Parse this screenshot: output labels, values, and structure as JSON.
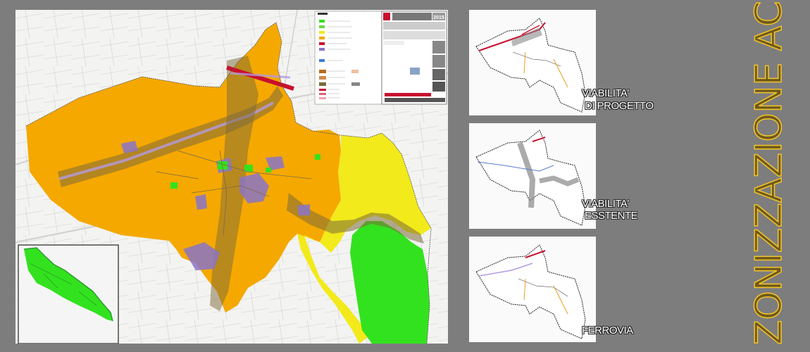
{
  "main_map": {
    "title_block": {
      "year": "2015"
    }
  },
  "thumbnails": [
    {
      "caption_line1": "VIABILITA'",
      "caption_line2": "DI PROGETTO"
    },
    {
      "caption_line1": "VIABILITA'",
      "caption_line2": "ESSTENTE"
    },
    {
      "caption_line1": "FERROVIA",
      "caption_line2": ""
    }
  ],
  "page_title": "ZONIZZAZIONE ACUSTICA",
  "colors": {
    "background": "#7d7d7d",
    "zone_orange": "#f5a800",
    "zone_yellow": "#f2ea1a",
    "zone_green": "#33e21f",
    "zone_purple": "#8a74c8",
    "buffer_brown": "#7b6a3a",
    "road_red": "#c8102e",
    "title_gold": "#f3c32a"
  }
}
